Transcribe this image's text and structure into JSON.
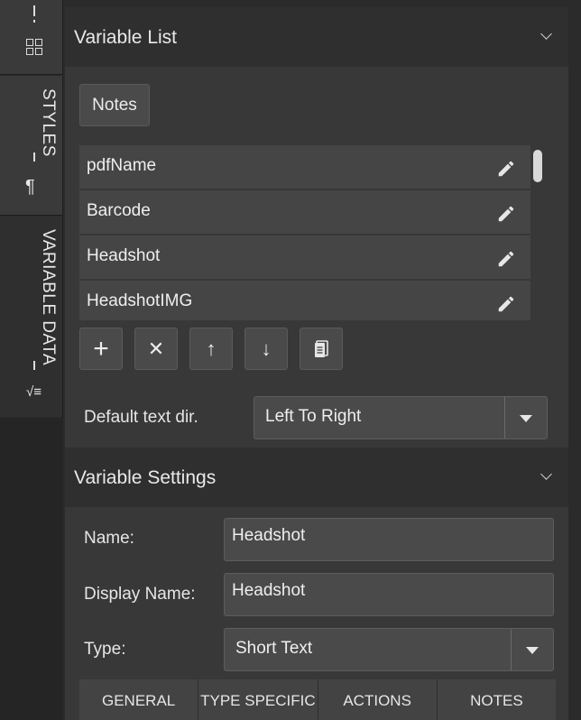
{
  "sidebar": {
    "tabs": [
      {
        "label": "STYLES",
        "icon": "pilcrow-icon",
        "glyph": "¶"
      },
      {
        "label": "VARIABLE DATA",
        "icon": "variable-formula-icon",
        "glyph": "√≡"
      }
    ]
  },
  "variable_list": {
    "title": "Variable List",
    "notes_button": "Notes",
    "items": [
      {
        "label": "pdfName"
      },
      {
        "label": "Barcode"
      },
      {
        "label": "Headshot"
      },
      {
        "label": "HeadshotIMG"
      }
    ],
    "toolbar": {
      "add": "+",
      "delete": "✕",
      "move_up": "↑",
      "move_down": "↓"
    },
    "text_dir": {
      "label": "Default text dir.",
      "value": "Left To Right"
    }
  },
  "variable_settings": {
    "title": "Variable Settings",
    "name_label": "Name:",
    "name_value": "Headshot",
    "display_name_label": "Display Name:",
    "display_name_value": "Headshot",
    "type_label": "Type:",
    "type_value": "Short Text",
    "tabs": [
      {
        "label": "GENERAL"
      },
      {
        "label": "TYPE SPECIFIC"
      },
      {
        "label": "ACTIONS"
      },
      {
        "label": "NOTES"
      }
    ]
  },
  "colors": {
    "background": "#383838",
    "header": "#2f2f2f",
    "row": "#454545",
    "control": "#4a4a4a",
    "text": "#e6e6e6"
  }
}
